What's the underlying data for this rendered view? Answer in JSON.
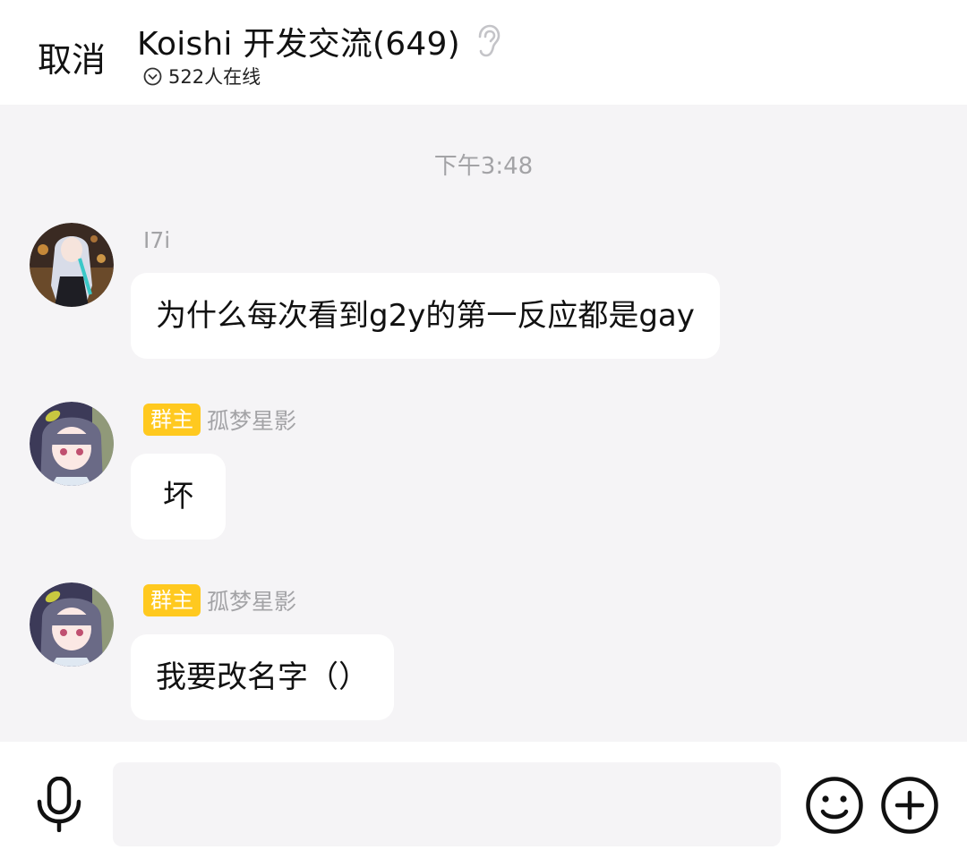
{
  "header": {
    "cancel_label": "取消",
    "title": "Koishi 开发交流(649)",
    "online_text": "522人在线",
    "ear_icon": "ear-icon",
    "online_icon": "chevron-circle-icon"
  },
  "chat": {
    "time_separator": "下午3:48",
    "messages": [
      {
        "sender": "I7i",
        "badge": "",
        "text": "为什么每次看到g2y的第一反应都是gay"
      },
      {
        "sender": "孤梦星影",
        "badge": "群主",
        "text": "坏"
      },
      {
        "sender": "孤梦星影",
        "badge": "群主",
        "text": "我要改名字（）"
      }
    ]
  },
  "input_bar": {
    "placeholder": "",
    "mic_icon": "microphone-icon",
    "emoji_icon": "emoji-icon",
    "plus_icon": "plus-icon"
  },
  "colors": {
    "badge": "#ffc91f",
    "chat_background": "#f5f4f6",
    "secondary_text": "#a3a3a6"
  }
}
